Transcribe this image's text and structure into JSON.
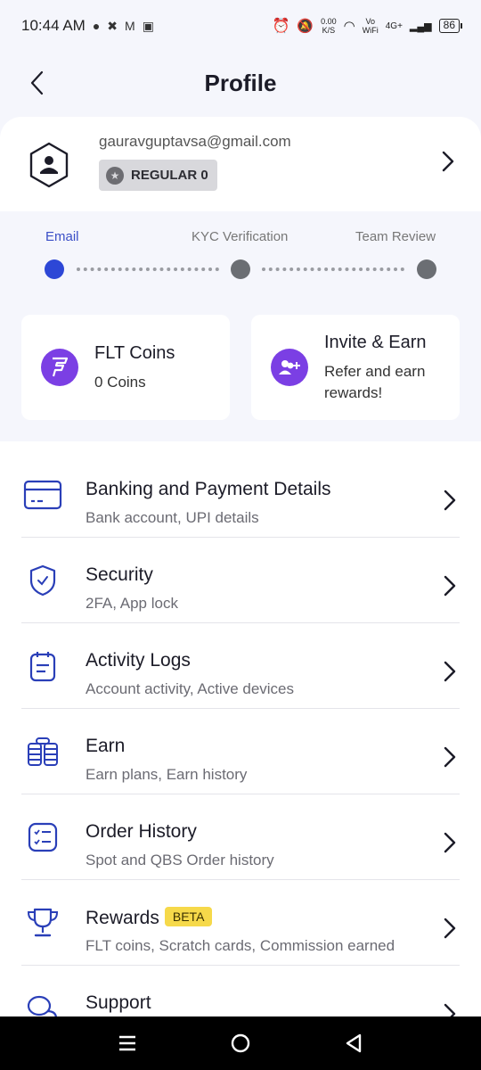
{
  "status_bar": {
    "time": "10:44 AM",
    "net_speed_value": "0.00",
    "net_speed_unit": "K/S",
    "vowifi_top": "Vo",
    "vowifi_bottom": "WiFi",
    "network": "4G+",
    "battery": "86"
  },
  "header": {
    "title": "Profile"
  },
  "user": {
    "email": "gauravguptavsa@gmail.com",
    "tier": "REGULAR 0"
  },
  "steps": [
    {
      "label": "Email",
      "active": true
    },
    {
      "label": "KYC Verification",
      "active": false
    },
    {
      "label": "Team Review",
      "active": false
    }
  ],
  "tiles": {
    "coins": {
      "title": "FLT Coins",
      "subtitle": "0 Coins"
    },
    "invite": {
      "title": "Invite & Earn",
      "subtitle_line1": "Refer and earn",
      "subtitle_line2": "rewards!"
    }
  },
  "menu": [
    {
      "title": "Banking and Payment Details",
      "subtitle": "Bank account, UPI details",
      "icon": "card-icon"
    },
    {
      "title": "Security",
      "subtitle": "2FA, App lock",
      "icon": "shield-icon"
    },
    {
      "title": "Activity Logs",
      "subtitle": "Account activity, Active devices",
      "icon": "calendar-icon"
    },
    {
      "title": "Earn",
      "subtitle": "Earn plans, Earn history",
      "icon": "coins-stack-icon"
    },
    {
      "title": "Order History",
      "subtitle": "Spot and QBS Order history",
      "icon": "checklist-icon"
    },
    {
      "title": "Rewards",
      "badge": "BETA",
      "subtitle": "FLT coins, Scratch cards, Commission earned",
      "icon": "trophy-icon"
    },
    {
      "title": "Support",
      "subtitle": "",
      "icon": "chat-bubbles-icon"
    }
  ],
  "colors": {
    "accent": "#2d47d6",
    "purple": "#7b3fe4",
    "beta": "#f6d94a",
    "icon_blue": "#2a3fb8"
  }
}
